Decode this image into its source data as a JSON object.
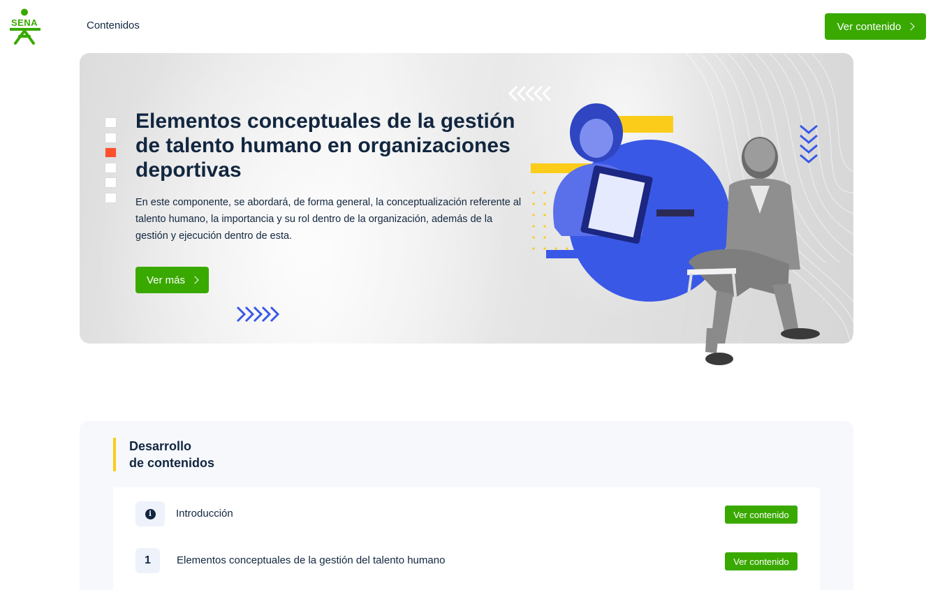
{
  "header": {
    "logo_text": "SENA",
    "nav_label": "Contenidos",
    "cta_label": "Ver contenido"
  },
  "banner": {
    "title": "Elementos conceptuales de la gestión de talento humano en organizaciones deportivas",
    "description": "En este componente, se abordará, de forma general, la conceptualización referente al talento humano, la importancia y su rol dentro de la organización, además de la gestión y ejecución dentro de esta.",
    "button_label": "Ver más",
    "slider": {
      "count": 6,
      "active_index": 2
    }
  },
  "section": {
    "title_line1": "Desarrollo",
    "title_line2": "de contenidos",
    "items": [
      {
        "marker": "info-icon",
        "label": "Introducción",
        "button_label": "Ver contenido"
      },
      {
        "marker": "1",
        "label": "Elementos conceptuales de la gestión del talento humano",
        "button_label": "Ver contenido"
      }
    ]
  },
  "colors": {
    "brand_green": "#39a900",
    "dark_text": "#12263f",
    "accent_yellow": "#fbcc1a",
    "accent_orange": "#fe502d",
    "accent_blue": "#3a58e6"
  }
}
